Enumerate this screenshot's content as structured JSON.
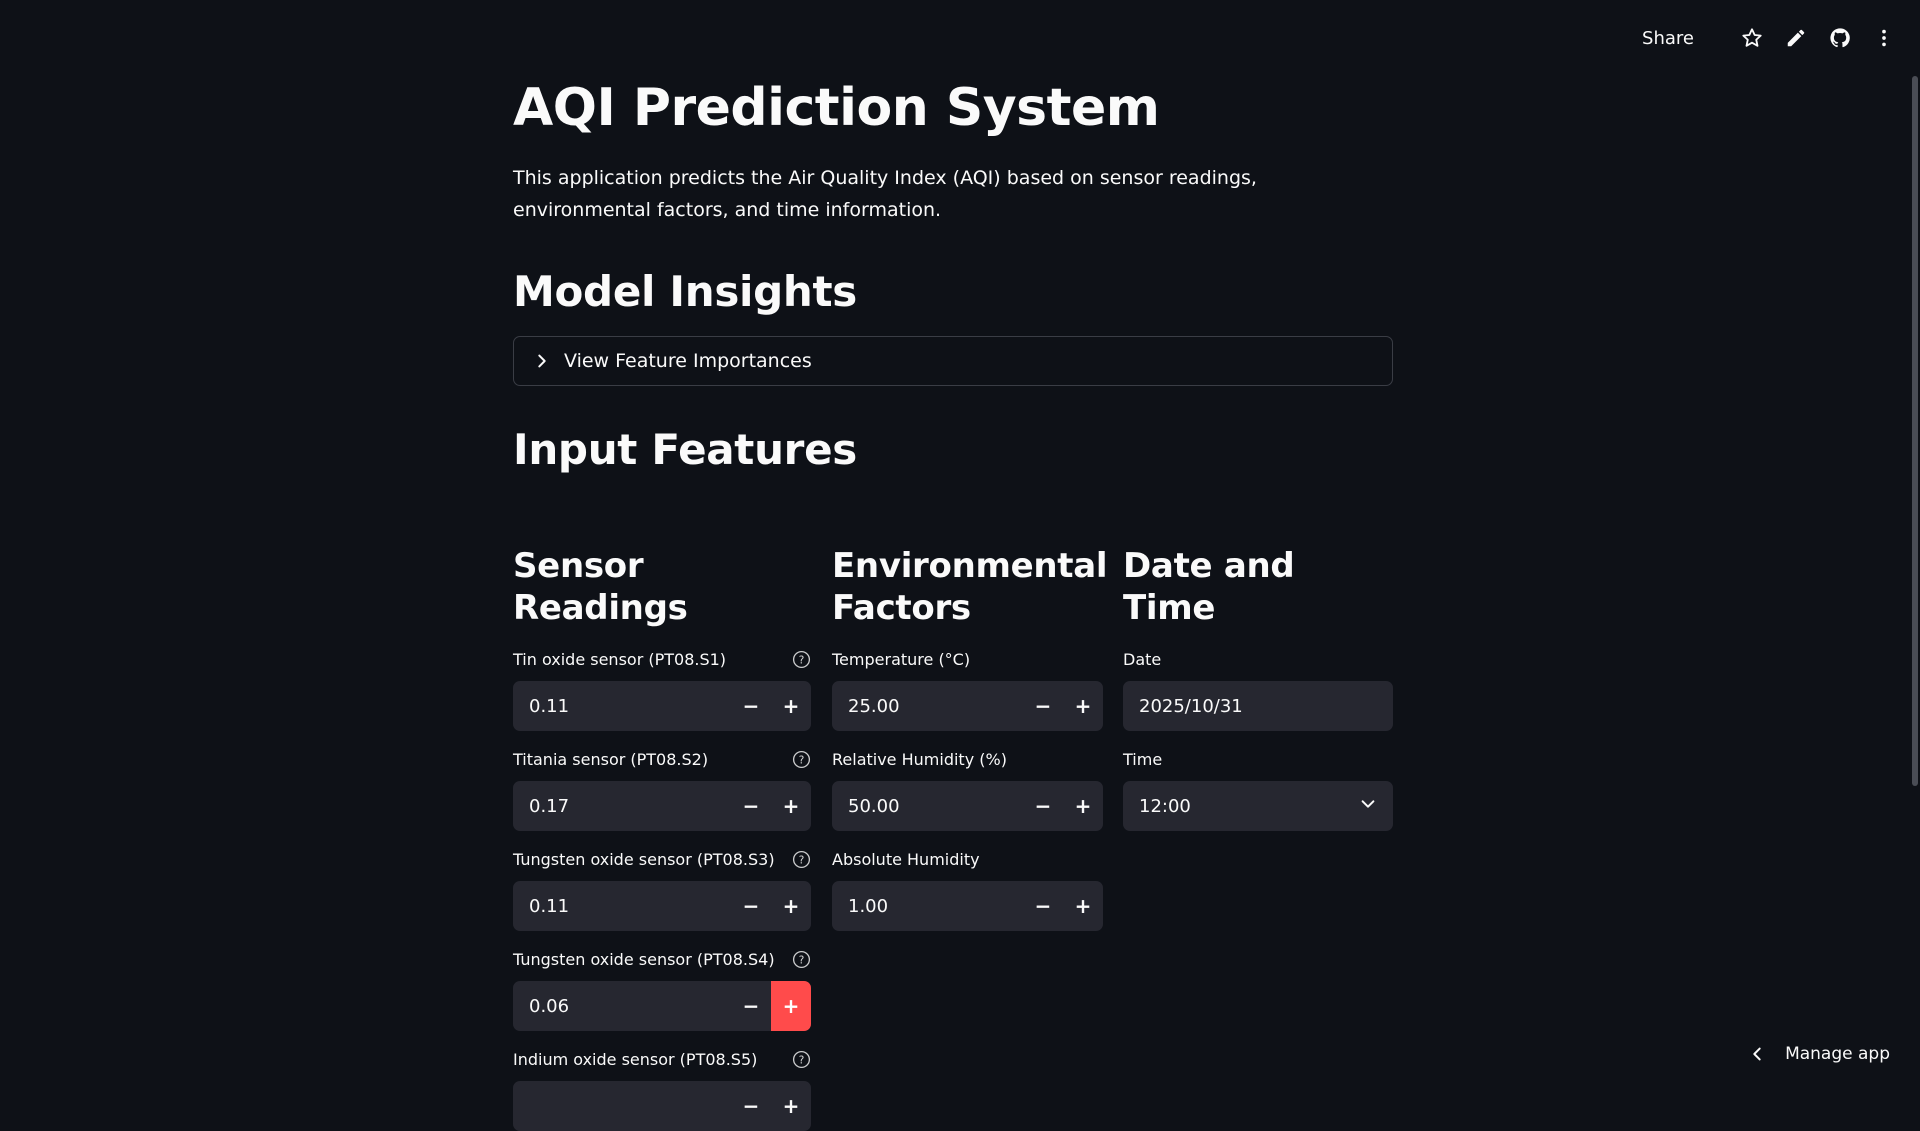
{
  "toolbar": {
    "share_label": "Share",
    "icons": [
      "star-icon",
      "pencil-icon",
      "github-icon",
      "more-vert-icon"
    ]
  },
  "header": {
    "title": "AQI Prediction System",
    "description": "This application predicts the Air Quality Index (AQI) based on sensor readings, environmental factors, and time information."
  },
  "model_insights": {
    "heading": "Model Insights",
    "expander_label": "View Feature Importances"
  },
  "input_features": {
    "heading": "Input Features"
  },
  "sensor_readings": {
    "heading": "Sensor Readings",
    "fields": [
      {
        "label": "Tin oxide sensor (PT08.S1)",
        "value": "0.11"
      },
      {
        "label": "Titania sensor (PT08.S2)",
        "value": "0.17"
      },
      {
        "label": "Tungsten oxide sensor (PT08.S3)",
        "value": "0.11"
      },
      {
        "label": "Tungsten oxide sensor (PT08.S4)",
        "value": "0.06"
      },
      {
        "label": "Indium oxide sensor (PT08.S5)",
        "value": ""
      }
    ]
  },
  "environmental": {
    "heading_line1": "Environmental",
    "heading_line2": "Factors",
    "fields": [
      {
        "label": "Temperature (°C)",
        "value": "25.00"
      },
      {
        "label": "Relative Humidity (%)",
        "value": "50.00"
      },
      {
        "label": "Absolute Humidity",
        "value": "1.00"
      }
    ]
  },
  "date_time": {
    "heading": "Date and Time",
    "date_label": "Date",
    "date_value": "2025/10/31",
    "time_label": "Time",
    "time_value": "12:00"
  },
  "footer": {
    "manage_app_label": "Manage app"
  },
  "colors": {
    "background": "#0e1117",
    "input_bg": "#262730",
    "accent": "#ff4b4b",
    "text": "#fafafa"
  }
}
